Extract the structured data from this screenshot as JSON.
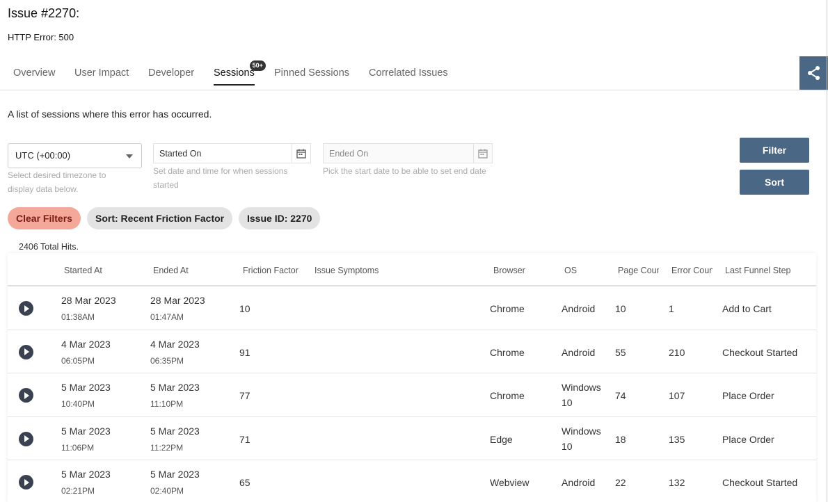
{
  "header": {
    "title": "Issue #2270:",
    "subtitle": "HTTP Error: 500"
  },
  "tabs": [
    {
      "label": "Overview"
    },
    {
      "label": "User Impact"
    },
    {
      "label": "Developer"
    },
    {
      "label": "Sessions",
      "badge": "50+",
      "active": true
    },
    {
      "label": "Pinned Sessions"
    },
    {
      "label": "Correlated Issues"
    }
  ],
  "intro": "A list of sessions where this error has occurred.",
  "filters": {
    "timezone_value": "UTC (+00:00)",
    "timezone_hint": "Select desired timezone to display data below.",
    "started_placeholder": "Started On",
    "started_hint": "Set date and time for when sessions started",
    "ended_placeholder": "Ended On",
    "ended_hint": "Pick the start date to be able to set end date",
    "filter_label": "Filter",
    "sort_label": "Sort"
  },
  "chips": {
    "clear": "Clear Filters",
    "sort": "Sort: Recent Friction Factor",
    "issue": "Issue ID: 2270"
  },
  "total_hits": "2406 Total Hits.",
  "table": {
    "headers": [
      "Started At",
      "Ended At",
      "Friction Factor",
      "Issue Symptoms",
      "Browser",
      "OS",
      "Page Count",
      "Error Count",
      "Last Funnel Step"
    ],
    "rows": [
      {
        "start_date": "28 Mar 2023",
        "start_time": "01:38AM",
        "end_date": "28 Mar 2023",
        "end_time": "01:47AM",
        "friction": "10",
        "browser": "Chrome",
        "os": "Android",
        "os2": "",
        "pages": "10",
        "errors": "1",
        "funnel": "Add to Cart"
      },
      {
        "start_date": "4 Mar 2023",
        "start_time": "06:05PM",
        "end_date": "4 Mar 2023",
        "end_time": "06:35PM",
        "friction": "91",
        "browser": "Chrome",
        "os": "Android",
        "os2": "",
        "pages": "55",
        "errors": "210",
        "funnel": "Checkout Started"
      },
      {
        "start_date": "5 Mar 2023",
        "start_time": "10:40PM",
        "end_date": "5 Mar 2023",
        "end_time": "11:10PM",
        "friction": "77",
        "browser": "Chrome",
        "os": "Windows",
        "os2": "10",
        "pages": "74",
        "errors": "107",
        "funnel": "Place Order"
      },
      {
        "start_date": "5 Mar 2023",
        "start_time": "11:06PM",
        "end_date": "5 Mar 2023",
        "end_time": "11:22PM",
        "friction": "71",
        "browser": "Edge",
        "os": "Windows",
        "os2": "10",
        "pages": "18",
        "errors": "135",
        "funnel": "Place Order"
      },
      {
        "start_date": "5 Mar 2023",
        "start_time": "02:21PM",
        "end_date": "5 Mar 2023",
        "end_time": "02:40PM",
        "friction": "65",
        "browser": "Webview",
        "os": "Android",
        "os2": "",
        "pages": "22",
        "errors": "132",
        "funnel": "Checkout Started"
      }
    ]
  },
  "colors": {
    "primary": "#4a6785",
    "clear_chip": "#f4a89a",
    "chip_gray": "#e3e3e3"
  }
}
